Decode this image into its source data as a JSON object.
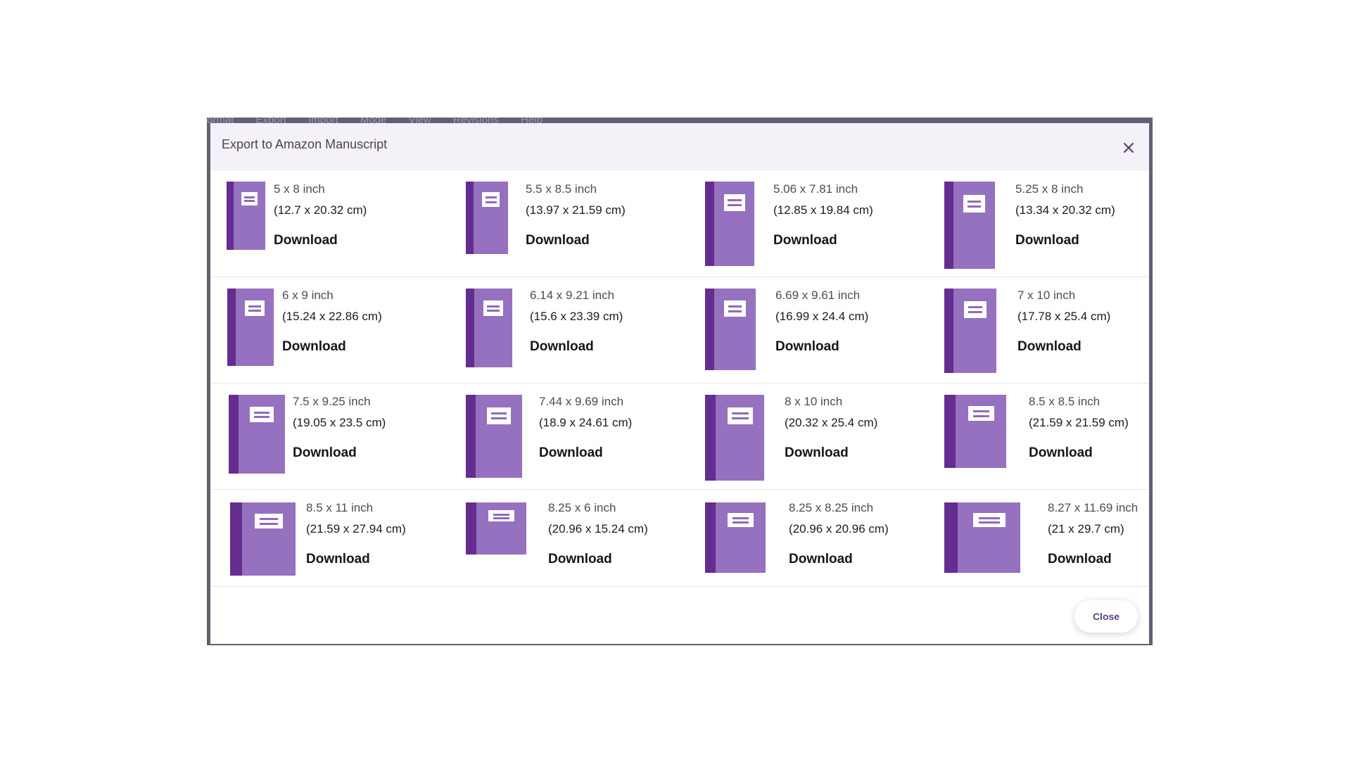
{
  "background_menu": [
    "ormat",
    "Export",
    "Import",
    "Mode",
    "View",
    "Revisions",
    "Help"
  ],
  "dialog": {
    "title": "Export to Amazon Manuscript",
    "close_label": "Close",
    "download_label": "Download"
  },
  "colors": {
    "spine": "#652d8f",
    "cover": "#9571c0",
    "header_bg": "#f4f1f8",
    "close_text": "#5b3f86"
  },
  "icons": {
    "book": "book-icon",
    "close": "close-icon"
  },
  "sizes": [
    {
      "inch": "5 x 8 inch",
      "cm": "(12.7 x 20.32 cm)"
    },
    {
      "inch": "5.5 x 8.5 inch",
      "cm": "(13.97 x 21.59 cm)"
    },
    {
      "inch": "5.06 x 7.81 inch",
      "cm": "(12.85 x 19.84 cm)"
    },
    {
      "inch": "5.25 x 8 inch",
      "cm": "(13.34 x 20.32 cm)"
    },
    {
      "inch": "6 x 9 inch",
      "cm": "(15.24 x 22.86 cm)"
    },
    {
      "inch": "6.14 x 9.21 inch",
      "cm": "(15.6 x 23.39 cm)"
    },
    {
      "inch": "6.69 x 9.61 inch",
      "cm": "(16.99 x 24.4 cm)"
    },
    {
      "inch": "7 x 10 inch",
      "cm": "(17.78 x 25.4 cm)"
    },
    {
      "inch": "7.5 x 9.25 inch",
      "cm": "(19.05 x 23.5 cm)"
    },
    {
      "inch": "7.44 x 9.69 inch",
      "cm": "(18.9 x 24.61 cm)"
    },
    {
      "inch": "8 x 10 inch",
      "cm": "(20.32 x 25.4 cm)"
    },
    {
      "inch": "8.5 x 8.5 inch",
      "cm": "(21.59 x 21.59 cm)"
    },
    {
      "inch": "8.5 x 11 inch",
      "cm": "(21.59 x 27.94 cm)"
    },
    {
      "inch": "8.25 x 6 inch",
      "cm": "(20.96 x 15.24 cm)"
    },
    {
      "inch": "8.25 x 8.25 inch",
      "cm": "(20.96 x 20.96 cm)"
    },
    {
      "inch": "8.27 x 11.69 inch",
      "cm": "(21 x 29.7 cm)"
    }
  ]
}
